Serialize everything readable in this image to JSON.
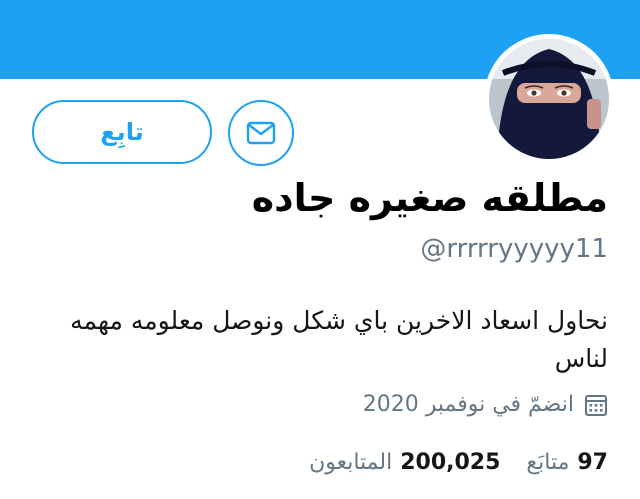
{
  "colors": {
    "accent": "#1da1f2",
    "banner": "#1da1f2",
    "secondary_text": "#657786",
    "primary_text": "#14171a"
  },
  "header": {
    "follow_label": "تابِع",
    "message_icon": "envelope-icon"
  },
  "profile": {
    "display_name": "مطلقه صغيره جاده",
    "handle": "@rrrrryyyyy11",
    "bio": "نحاول اسعاد الاخرين باي شكل ونوصل معلومه مهمه لناس",
    "joined_icon": "calendar-icon",
    "joined_text": "انضمّ في نوفمبر 2020"
  },
  "stats": {
    "following_count": "97",
    "following_label": "متابَع",
    "followers_count": "200,025",
    "followers_label": "المتابعون"
  }
}
